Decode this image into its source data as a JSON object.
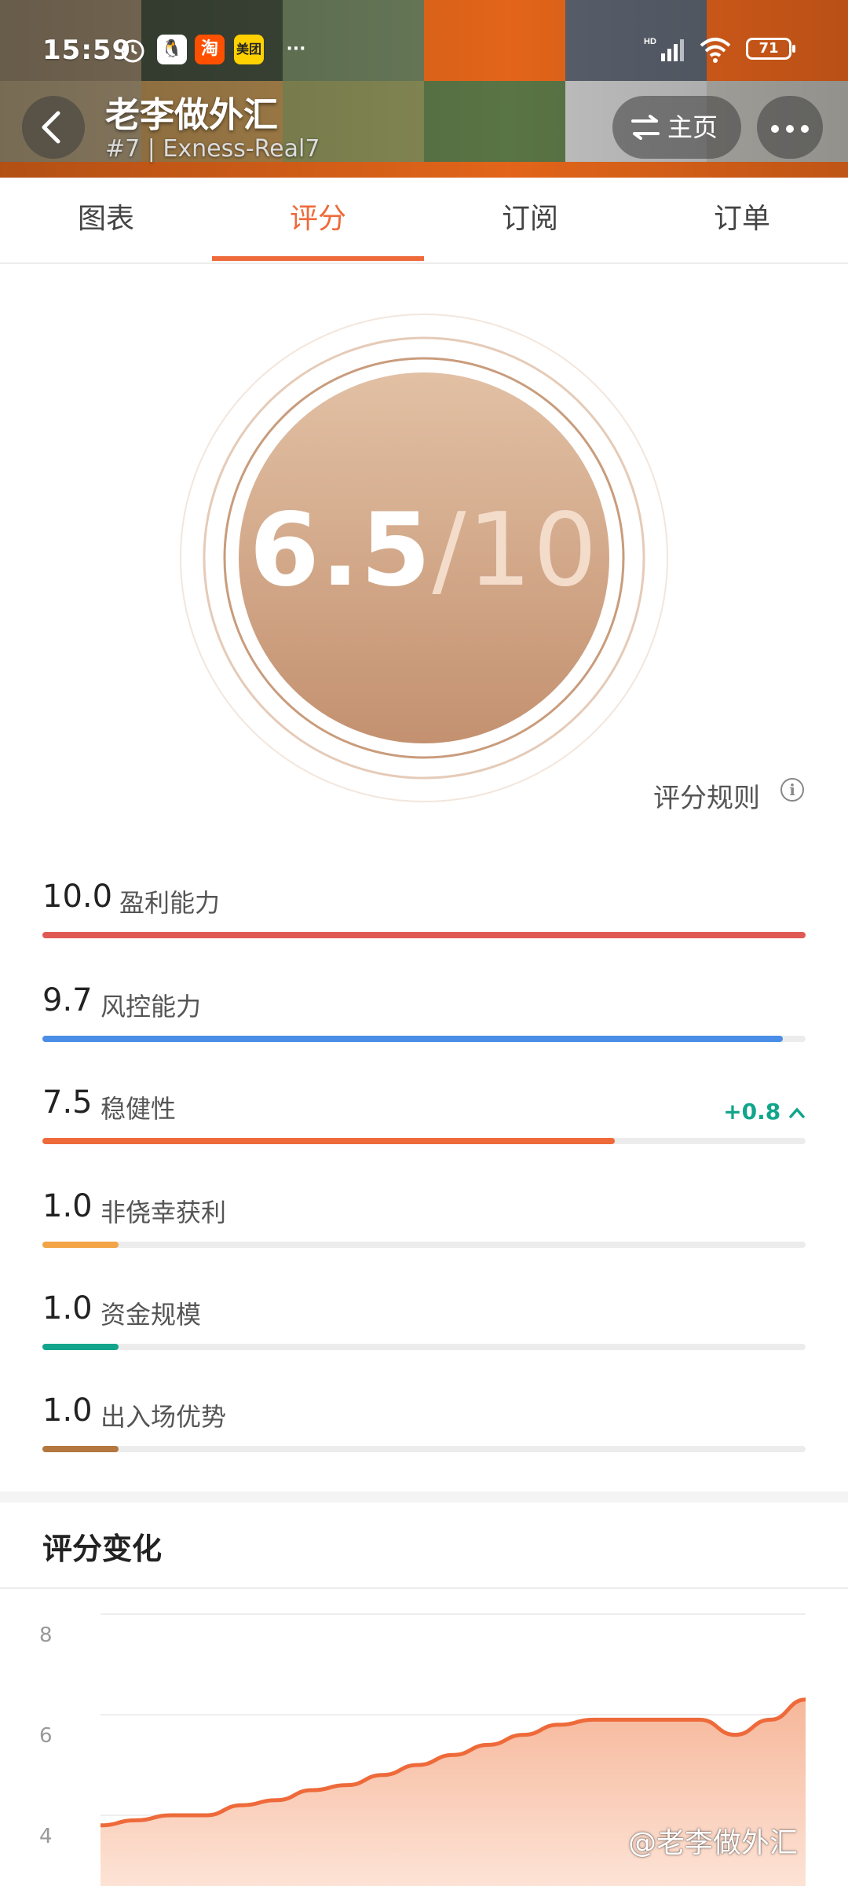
{
  "status_bar": {
    "time": "15:59",
    "battery": "71",
    "network_badge": "HD"
  },
  "header": {
    "trader_name": "老李做外汇",
    "trader_sub": "#7 | Exness-Real7",
    "home_label": "主页"
  },
  "tabs": [
    {
      "label": "图表",
      "active": false
    },
    {
      "label": "评分",
      "active": true
    },
    {
      "label": "订阅",
      "active": false
    },
    {
      "label": "订单",
      "active": false
    }
  ],
  "score": {
    "value": "6.5",
    "max": "/10",
    "rules_label": "评分规则"
  },
  "metrics": [
    {
      "value": "10.0",
      "label": "盈利能力",
      "score": 10.0,
      "color": "#e05a54"
    },
    {
      "value": "9.7",
      "label": "风控能力",
      "score": 9.7,
      "color": "#4a8ee8"
    },
    {
      "value": "7.5",
      "label": "稳健性",
      "score": 7.5,
      "color": "#ee6a3a",
      "delta": "+0.8"
    },
    {
      "value": "1.0",
      "label": "非侥幸获利",
      "score": 1.0,
      "color": "#f3a446"
    },
    {
      "value": "1.0",
      "label": "资金规模",
      "score": 1.0,
      "color": "#12a58c"
    },
    {
      "value": "1.0",
      "label": "出入场优势",
      "score": 1.0,
      "color": "#b3773f"
    }
  ],
  "chart_section": {
    "title": "评分变化"
  },
  "chart_data": {
    "type": "area",
    "title": "评分变化",
    "y_ticks": [
      "8",
      "6",
      "4"
    ],
    "ylim": [
      2,
      8
    ],
    "grid": true,
    "x": [
      0,
      1,
      2,
      3,
      4,
      5,
      6,
      7,
      8,
      9,
      10,
      11,
      12,
      13,
      14,
      15,
      16,
      17,
      18,
      19,
      20
    ],
    "values": [
      3.8,
      3.9,
      4.0,
      4.0,
      4.2,
      4.3,
      4.5,
      4.6,
      4.8,
      5.0,
      5.2,
      5.4,
      5.6,
      5.8,
      5.9,
      5.9,
      5.9,
      5.9,
      5.6,
      5.9,
      6.3
    ],
    "line_color": "#ee6a3a"
  },
  "watermark": "@老李做外汇"
}
